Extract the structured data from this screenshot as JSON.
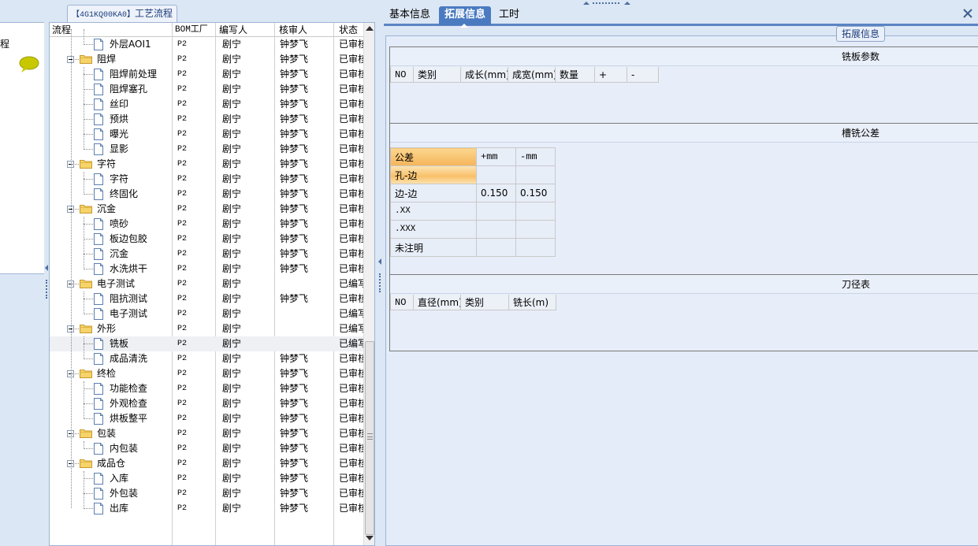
{
  "left_strip": {
    "label": "程"
  },
  "tree": {
    "title_code": "【4G1KQ00KA0】",
    "title_text": "工艺流程",
    "columns": [
      "流程",
      "BOM工厂",
      "编写人",
      "核审人",
      "状态"
    ],
    "rows": [
      {
        "level": 2,
        "type": "doc",
        "name": "外层AOI1",
        "bom": "P2",
        "writer": "剧宁",
        "reviewer": "钟梦飞",
        "status": "已审核"
      },
      {
        "level": 1,
        "type": "folder",
        "name": "阻焊",
        "bom": "P2",
        "writer": "剧宁",
        "reviewer": "钟梦飞",
        "status": "已审核"
      },
      {
        "level": 2,
        "type": "doc",
        "name": "阻焊前处理",
        "bom": "P2",
        "writer": "剧宁",
        "reviewer": "钟梦飞",
        "status": "已审核"
      },
      {
        "level": 2,
        "type": "doc",
        "name": "阻焊塞孔",
        "bom": "P2",
        "writer": "剧宁",
        "reviewer": "钟梦飞",
        "status": "已审核"
      },
      {
        "level": 2,
        "type": "doc",
        "name": "丝印",
        "bom": "P2",
        "writer": "剧宁",
        "reviewer": "钟梦飞",
        "status": "已审核"
      },
      {
        "level": 2,
        "type": "doc",
        "name": "预烘",
        "bom": "P2",
        "writer": "剧宁",
        "reviewer": "钟梦飞",
        "status": "已审核"
      },
      {
        "level": 2,
        "type": "doc",
        "name": "曝光",
        "bom": "P2",
        "writer": "剧宁",
        "reviewer": "钟梦飞",
        "status": "已审核"
      },
      {
        "level": 2,
        "type": "doc",
        "name": "显影",
        "bom": "P2",
        "writer": "剧宁",
        "reviewer": "钟梦飞",
        "status": "已审核"
      },
      {
        "level": 1,
        "type": "folder",
        "name": "字符",
        "bom": "P2",
        "writer": "剧宁",
        "reviewer": "钟梦飞",
        "status": "已审核"
      },
      {
        "level": 2,
        "type": "doc",
        "name": "字符",
        "bom": "P2",
        "writer": "剧宁",
        "reviewer": "钟梦飞",
        "status": "已审核"
      },
      {
        "level": 2,
        "type": "doc",
        "name": "终固化",
        "bom": "P2",
        "writer": "剧宁",
        "reviewer": "钟梦飞",
        "status": "已审核"
      },
      {
        "level": 1,
        "type": "folder",
        "name": "沉金",
        "bom": "P2",
        "writer": "剧宁",
        "reviewer": "钟梦飞",
        "status": "已审核"
      },
      {
        "level": 2,
        "type": "doc",
        "name": "喷砂",
        "bom": "P2",
        "writer": "剧宁",
        "reviewer": "钟梦飞",
        "status": "已审核"
      },
      {
        "level": 2,
        "type": "doc",
        "name": "板边包胶",
        "bom": "P2",
        "writer": "剧宁",
        "reviewer": "钟梦飞",
        "status": "已审核"
      },
      {
        "level": 2,
        "type": "doc",
        "name": "沉金",
        "bom": "P2",
        "writer": "剧宁",
        "reviewer": "钟梦飞",
        "status": "已审核"
      },
      {
        "level": 2,
        "type": "doc",
        "name": "水洗烘干",
        "bom": "P2",
        "writer": "剧宁",
        "reviewer": "钟梦飞",
        "status": "已审核"
      },
      {
        "level": 1,
        "type": "folder",
        "name": "电子测试",
        "bom": "P2",
        "writer": "剧宁",
        "reviewer": "",
        "status": "已编写"
      },
      {
        "level": 2,
        "type": "doc",
        "name": "阻抗测试",
        "bom": "P2",
        "writer": "剧宁",
        "reviewer": "钟梦飞",
        "status": "已审核"
      },
      {
        "level": 2,
        "type": "doc",
        "name": "电子测试",
        "bom": "P2",
        "writer": "剧宁",
        "reviewer": "",
        "status": "已编写"
      },
      {
        "level": 1,
        "type": "folder",
        "name": "外形",
        "bom": "P2",
        "writer": "剧宁",
        "reviewer": "",
        "status": "已编写"
      },
      {
        "level": 2,
        "type": "doc",
        "name": "铣板",
        "bom": "P2",
        "writer": "剧宁",
        "reviewer": "",
        "status": "已编写",
        "selected": true
      },
      {
        "level": 2,
        "type": "doc",
        "name": "成品清洗",
        "bom": "P2",
        "writer": "剧宁",
        "reviewer": "钟梦飞",
        "status": "已审核"
      },
      {
        "level": 1,
        "type": "folder",
        "name": "终检",
        "bom": "P2",
        "writer": "剧宁",
        "reviewer": "钟梦飞",
        "status": "已审核"
      },
      {
        "level": 2,
        "type": "doc",
        "name": "功能检查",
        "bom": "P2",
        "writer": "剧宁",
        "reviewer": "钟梦飞",
        "status": "已审核"
      },
      {
        "level": 2,
        "type": "doc",
        "name": "外观检查",
        "bom": "P2",
        "writer": "剧宁",
        "reviewer": "钟梦飞",
        "status": "已审核"
      },
      {
        "level": 2,
        "type": "doc",
        "name": "烘板整平",
        "bom": "P2",
        "writer": "剧宁",
        "reviewer": "钟梦飞",
        "status": "已审核"
      },
      {
        "level": 1,
        "type": "folder",
        "name": "包装",
        "bom": "P2",
        "writer": "剧宁",
        "reviewer": "钟梦飞",
        "status": "已审核"
      },
      {
        "level": 2,
        "type": "doc",
        "name": "内包装",
        "bom": "P2",
        "writer": "剧宁",
        "reviewer": "钟梦飞",
        "status": "已审核"
      },
      {
        "level": 1,
        "type": "folder",
        "name": "成品仓",
        "bom": "P2",
        "writer": "剧宁",
        "reviewer": "钟梦飞",
        "status": "已审核"
      },
      {
        "level": 2,
        "type": "doc",
        "name": "入库",
        "bom": "P2",
        "writer": "剧宁",
        "reviewer": "钟梦飞",
        "status": "已审核"
      },
      {
        "level": 2,
        "type": "doc",
        "name": "外包装",
        "bom": "P2",
        "writer": "剧宁",
        "reviewer": "钟梦飞",
        "status": "已审核"
      },
      {
        "level": 2,
        "type": "doc",
        "name": "出库",
        "bom": "P2",
        "writer": "剧宁",
        "reviewer": "钟梦飞",
        "status": "已审核"
      }
    ]
  },
  "tabs": [
    {
      "label": "基本信息",
      "active": false
    },
    {
      "label": "拓展信息",
      "active": true
    },
    {
      "label": "工时",
      "active": false
    }
  ],
  "group_legend": "拓展信息",
  "milling_params": {
    "title": "铣板参数",
    "columns": [
      "NO",
      "类别",
      "成长(mm)",
      "成宽(mm)",
      "数量",
      "+",
      "-"
    ]
  },
  "slot_tolerance": {
    "title": "槽铣公差",
    "header": [
      "公差",
      "+mm",
      "-mm"
    ],
    "rows": [
      {
        "label": "孔-边",
        "plus": "",
        "minus": ""
      },
      {
        "label": "边-边",
        "plus": "0.150",
        "minus": "0.150"
      },
      {
        "label": ".XX",
        "plus": "",
        "minus": ""
      },
      {
        "label": ".XXX",
        "plus": "",
        "minus": ""
      },
      {
        "label": "未注明",
        "plus": "",
        "minus": ""
      }
    ]
  },
  "tool_table": {
    "title": "刀径表",
    "columns": [
      "NO",
      "直径(mm)",
      "类别",
      "铣长(m)"
    ]
  },
  "colors": {
    "accent": "#4a7bc0",
    "panel_bg": "#dce7f5",
    "highlight_orange": "#f5b45a"
  }
}
